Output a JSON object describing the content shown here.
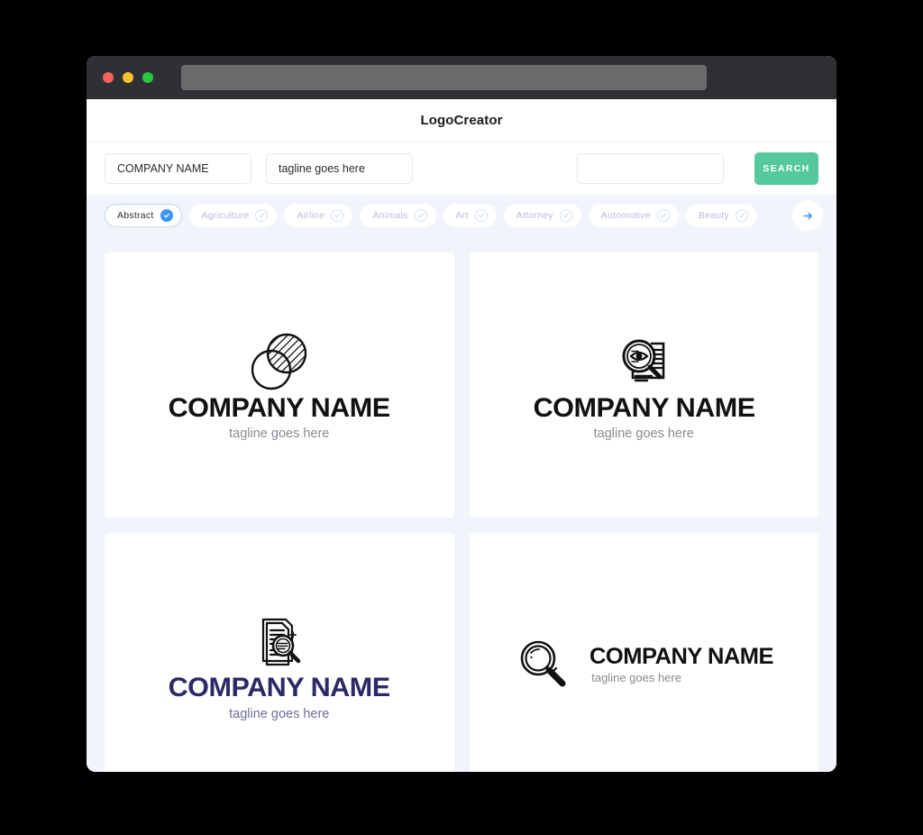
{
  "window": {
    "traffic_lights": [
      "close",
      "minimize",
      "maximize"
    ],
    "url_value": ""
  },
  "header": {
    "title": "LogoCreator"
  },
  "search": {
    "company_value": "COMPANY NAME",
    "company_placeholder": "COMPANY NAME",
    "tagline_value": "tagline goes here",
    "tagline_placeholder": "tagline goes here",
    "third_value": "",
    "third_placeholder": "",
    "button_label": "SEARCH"
  },
  "tabs": {
    "items": [
      {
        "label": "Abstract",
        "selected": true
      },
      {
        "label": "Agriculture",
        "selected": false
      },
      {
        "label": "Airline",
        "selected": false
      },
      {
        "label": "Animals",
        "selected": false
      },
      {
        "label": "Art",
        "selected": false
      },
      {
        "label": "Attorney",
        "selected": false
      },
      {
        "label": "Automotive",
        "selected": false
      },
      {
        "label": "Beauty",
        "selected": false
      }
    ],
    "next_icon": "arrow-right-icon"
  },
  "results": [
    {
      "icon": "overlapping-circles-icon",
      "company": "COMPANY NAME",
      "tagline": "tagline goes here",
      "color": "#111113",
      "layout": "stacked"
    },
    {
      "icon": "magnifier-eye-document-icon",
      "company": "COMPANY NAME",
      "tagline": "tagline goes here",
      "color": "#111113",
      "layout": "stacked"
    },
    {
      "icon": "document-magnifier-icon",
      "company": "COMPANY NAME",
      "tagline": "tagline goes here",
      "color": "#2b2a67",
      "layout": "stacked"
    },
    {
      "icon": "magnifier-icon",
      "company": "COMPANY NAME",
      "tagline": "tagline goes here",
      "color": "#111113",
      "layout": "horizontal"
    }
  ],
  "colors": {
    "accent_green": "#55c99d",
    "accent_blue": "#3b95f5",
    "navy": "#2b2a67",
    "page_bg": "#f2f4fc",
    "titlebar": "#2e3034"
  }
}
